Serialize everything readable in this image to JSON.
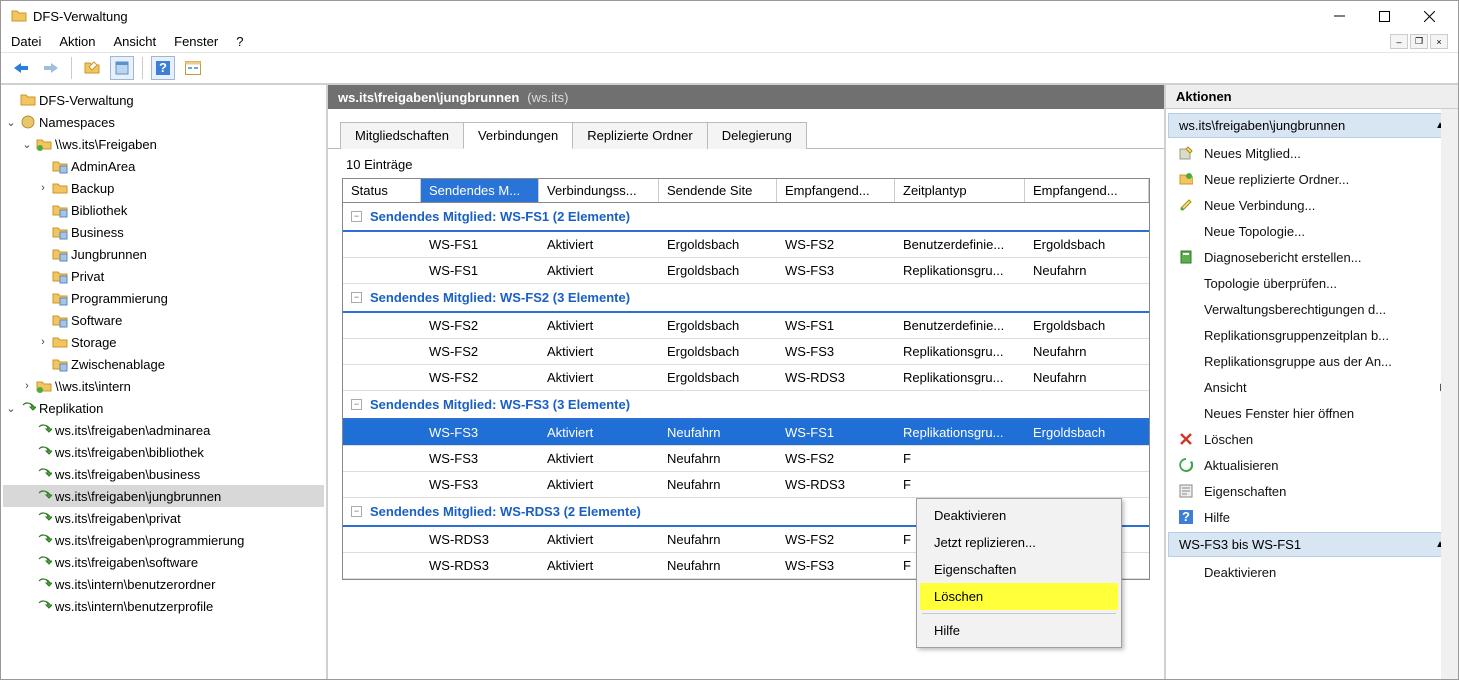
{
  "window": {
    "title": "DFS-Verwaltung"
  },
  "menubar": {
    "items": [
      "Datei",
      "Aktion",
      "Ansicht",
      "Fenster",
      "?"
    ]
  },
  "tree": {
    "root": "DFS-Verwaltung",
    "namespaces": "Namespaces",
    "ns_host": "\\\\ws.its\\Freigaben",
    "ns_children": [
      "AdminArea",
      "Backup",
      "Bibliothek",
      "Business",
      "Jungbrunnen",
      "Privat",
      "Programmierung",
      "Software",
      "Storage",
      "Zwischenablage"
    ],
    "ns_host2": "\\\\ws.its\\intern",
    "replication": "Replikation",
    "rep_children": [
      "ws.its\\freigaben\\adminarea",
      "ws.its\\freigaben\\bibliothek",
      "ws.its\\freigaben\\business",
      "ws.its\\freigaben\\jungbrunnen",
      "ws.its\\freigaben\\privat",
      "ws.its\\freigaben\\programmierung",
      "ws.its\\freigaben\\software",
      "ws.its\\intern\\benutzerordner",
      "ws.its\\intern\\benutzerprofile"
    ],
    "rep_selected_index": 3
  },
  "center": {
    "header_path": "ws.its\\freigaben\\jungbrunnen",
    "header_paren": "(ws.its)",
    "tabs": [
      "Mitgliedschaften",
      "Verbindungen",
      "Replizierte Ordner",
      "Delegierung"
    ],
    "active_tab_index": 1,
    "entries_label": "10 Einträge",
    "columns": [
      "Status",
      "Sendendes M...",
      "Verbindungss...",
      "Sendende Site",
      "Empfangend...",
      "Zeitplantyp",
      "Empfangend..."
    ],
    "sort_col_index": 1,
    "groups": [
      {
        "title": "Sendendes Mitglied: WS-FS1 (2 Elemente)",
        "rows": [
          {
            "c": [
              "",
              "WS-FS1",
              "Aktiviert",
              "Ergoldsbach",
              "WS-FS2",
              "Benutzerdefinie...",
              "Ergoldsbach"
            ]
          },
          {
            "c": [
              "",
              "WS-FS1",
              "Aktiviert",
              "Ergoldsbach",
              "WS-FS3",
              "Replikationsgru...",
              "Neufahrn"
            ]
          }
        ]
      },
      {
        "title": "Sendendes Mitglied: WS-FS2 (3 Elemente)",
        "rows": [
          {
            "c": [
              "",
              "WS-FS2",
              "Aktiviert",
              "Ergoldsbach",
              "WS-FS1",
              "Benutzerdefinie...",
              "Ergoldsbach"
            ]
          },
          {
            "c": [
              "",
              "WS-FS2",
              "Aktiviert",
              "Ergoldsbach",
              "WS-FS3",
              "Replikationsgru...",
              "Neufahrn"
            ]
          },
          {
            "c": [
              "",
              "WS-FS2",
              "Aktiviert",
              "Ergoldsbach",
              "WS-RDS3",
              "Replikationsgru...",
              "Neufahrn"
            ]
          }
        ]
      },
      {
        "title": "Sendendes Mitglied: WS-FS3 (3 Elemente)",
        "rows": [
          {
            "c": [
              "",
              "WS-FS3",
              "Aktiviert",
              "Neufahrn",
              "WS-FS1",
              "Replikationsgru...",
              "Ergoldsbach"
            ],
            "selected": true
          },
          {
            "c": [
              "",
              "WS-FS3",
              "Aktiviert",
              "Neufahrn",
              "WS-FS2",
              "F",
              "",
              ""
            ]
          },
          {
            "c": [
              "",
              "WS-FS3",
              "Aktiviert",
              "Neufahrn",
              "WS-RDS3",
              "F",
              "",
              ""
            ]
          }
        ]
      },
      {
        "title": "Sendendes Mitglied: WS-RDS3 (2 Elemente)",
        "rows": [
          {
            "c": [
              "",
              "WS-RDS3",
              "Aktiviert",
              "Neufahrn",
              "WS-FS2",
              "F",
              "",
              ""
            ]
          },
          {
            "c": [
              "",
              "WS-RDS3",
              "Aktiviert",
              "Neufahrn",
              "WS-FS3",
              "F",
              "",
              ""
            ]
          }
        ]
      }
    ]
  },
  "context_menu": {
    "items": [
      "Deaktivieren",
      "Jetzt replizieren...",
      "Eigenschaften",
      "Löschen",
      "",
      "Hilfe"
    ],
    "highlight_index": 3
  },
  "actions": {
    "header": "Aktionen",
    "section1_title": "ws.its\\freigaben\\jungbrunnen",
    "items1": [
      "Neues Mitglied...",
      "Neue replizierte Ordner...",
      "Neue Verbindung...",
      "Neue Topologie...",
      "Diagnosebericht erstellen...",
      "Topologie überprüfen...",
      "Verwaltungsberechtigungen d...",
      "Replikationsgruppenzeitplan b...",
      "Replikationsgruppe aus der An...",
      "Ansicht",
      "Neues Fenster hier öffnen",
      "Löschen",
      "Aktualisieren",
      "Eigenschaften",
      "Hilfe"
    ],
    "section2_title": "WS-FS3 bis WS-FS1",
    "items2_first": "Deaktivieren"
  }
}
